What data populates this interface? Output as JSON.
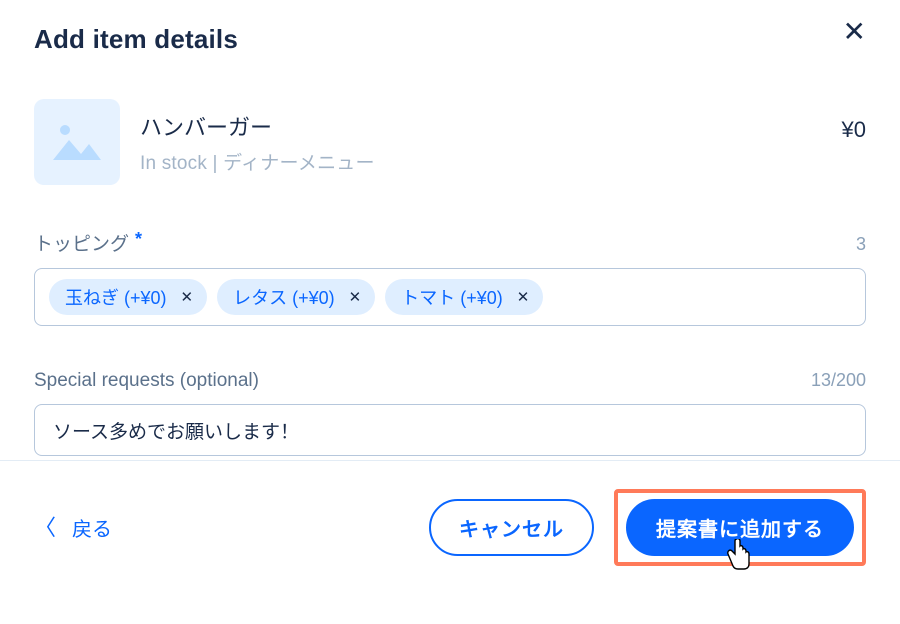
{
  "header": {
    "title": "Add item details"
  },
  "item": {
    "name": "ハンバーガー",
    "stock_label": "In stock",
    "menu_label": "ディナーメニュー",
    "price": "¥0"
  },
  "toppings": {
    "label": "トッピング",
    "count": "3",
    "chips": [
      {
        "label": "玉ねぎ (+¥0)"
      },
      {
        "label": "レタス (+¥0)"
      },
      {
        "label": "トマト (+¥0)"
      }
    ]
  },
  "special": {
    "label": "Special requests (optional)",
    "count": "13/200",
    "value": "ソース多めでお願いします！"
  },
  "footer": {
    "back": "戻る",
    "cancel": "キャンセル",
    "submit": "提案書に追加する"
  }
}
